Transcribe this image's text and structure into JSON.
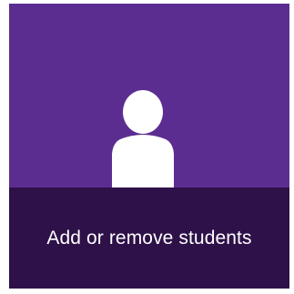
{
  "tile": {
    "label": "Add or remove students",
    "icon": "person-icon"
  },
  "colors": {
    "tile_background": "#5c2d91",
    "footer_background": "#2e1148",
    "text": "#ffffff",
    "icon_fill": "#ffffff",
    "icon_shadow": "#7a7a7a"
  }
}
